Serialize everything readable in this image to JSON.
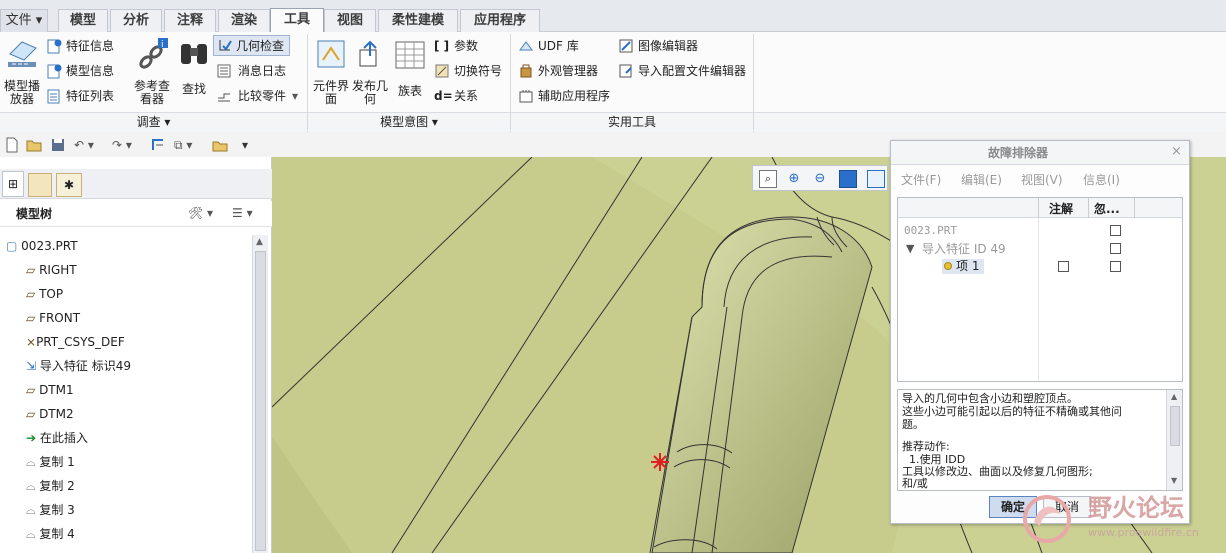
{
  "menu_tabs": [
    "文件",
    "模型",
    "分析",
    "注释",
    "渲染",
    "工具",
    "视图",
    "柔性建模",
    "应用程序"
  ],
  "active_tab": "工具",
  "ribbon": {
    "model_player": "模型播放器",
    "feature_info": "特征信息",
    "model_info": "模型信息",
    "feature_list": "特征列表",
    "ref_viewer": "参考查看器",
    "find": "查找",
    "geometry_check": "几何检查",
    "message_log": "消息日志",
    "compare_part": "比较零件",
    "component_interface": "元件界面",
    "publish_geometry": "发布几何",
    "family_table": "族表",
    "parameters": "参数",
    "switch_symbols": "切换符号",
    "relations": "关系",
    "udf_library": "UDF 库",
    "appearance_manager": "外观管理器",
    "auxiliary_apps": "辅助应用程序",
    "image_editor": "图像编辑器",
    "import_config_editor": "导入配置文件编辑器",
    "group_investigate": "调查",
    "group_model_intent": "模型意图",
    "group_utilities": "实用工具"
  },
  "model_tree": {
    "title": "模型树",
    "items": [
      {
        "label": "0023.PRT",
        "icon": "part-icon"
      },
      {
        "label": "RIGHT",
        "icon": "datum-plane-icon"
      },
      {
        "label": "TOP",
        "icon": "datum-plane-icon"
      },
      {
        "label": "FRONT",
        "icon": "datum-plane-icon"
      },
      {
        "label": "PRT_CSYS_DEF",
        "icon": "csys-icon"
      },
      {
        "label": "导入特征 标识49",
        "icon": "import-feature-icon"
      },
      {
        "label": "DTM1",
        "icon": "datum-plane-icon"
      },
      {
        "label": "DTM2",
        "icon": "datum-plane-icon"
      },
      {
        "label": "在此插入",
        "icon": "insert-arrow-icon"
      },
      {
        "label": "复制 1",
        "icon": "copy-icon"
      },
      {
        "label": "复制 2",
        "icon": "copy-icon"
      },
      {
        "label": "复制 3",
        "icon": "copy-icon"
      },
      {
        "label": "复制 4",
        "icon": "copy-icon"
      }
    ]
  },
  "dialog": {
    "title": "故障排除器",
    "menus": [
      "文件(F)",
      "编辑(E)",
      "视图(V)",
      "信息(I)"
    ],
    "columns": [
      "注解",
      "忽..."
    ],
    "tree": {
      "root": "0023.PRT",
      "node": "导入特征 ID 49",
      "leaf": "项 1"
    },
    "message_lines": [
      "导入的几何中包含小边和塑腔顶点。",
      "这些小边可能引起以后的特征不精确或其他问",
      "题。",
      "",
      "推荐动作:",
      "  1.使用 IDD",
      "工具以修改边、曲面以及修复几何图形;",
      "和/或"
    ],
    "ok": "确定",
    "cancel": "取消"
  },
  "watermark": {
    "text": "野火论坛",
    "url": "www.proewildfire.cn"
  },
  "colors": {
    "model_surface": "#c7cc8d",
    "selection_highlight": "#dde6f2",
    "error_marker": "#e02020"
  }
}
